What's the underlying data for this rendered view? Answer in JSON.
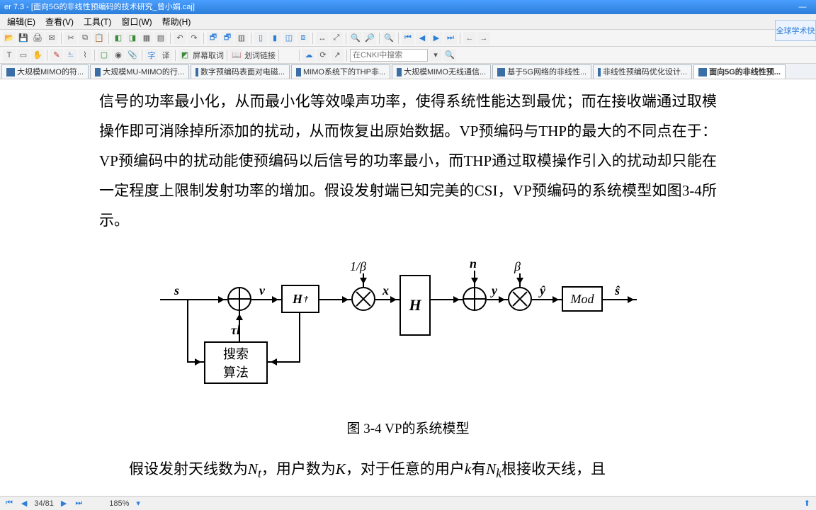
{
  "window": {
    "title_prefix": "er 7.3 - ",
    "doc_title": "[面向5G的非线性预编码的技术研究_曾小娟.caj]"
  },
  "menu": {
    "items": [
      "编辑(E)",
      "查看(V)",
      "工具(T)",
      "窗口(W)",
      "帮助(H)"
    ]
  },
  "toolbar2": {
    "layer_label": "屏幕取词",
    "dict_label": "划词链接",
    "search_placeholder": "在CNKI中搜索"
  },
  "right_float": "全球学术快",
  "tabs": [
    {
      "label": "大规模MIMO的符...",
      "active": false
    },
    {
      "label": "大规模MU-MIMO的行...",
      "active": false
    },
    {
      "label": "数字预编码表面对电磁...",
      "active": false
    },
    {
      "label": "MIMO系统下的THP非...",
      "active": false
    },
    {
      "label": "大规模MIMO无线通信...",
      "active": false
    },
    {
      "label": "基于5G网络的非线性...",
      "active": false
    },
    {
      "label": "非线性预编码优化设计...",
      "active": false
    },
    {
      "label": "面向5G的非线性预...",
      "active": true
    }
  ],
  "body": {
    "p1": "信号的功率最小化，从而最小化等效噪声功率，使得系统性能达到最优；而在接收端通过取模操作即可消除掉所添加的扰动，从而恢复出原始数据。VP预编码与THP的最大的不同点在于：VP预编码中的扰动能使预编码以后信号的功率最小，而THP通过取模操作引入的扰动却只能在一定程度上限制发射功率的增加。假设发射端已知完美的CSI，VP预编码的系统模型如图3-4所示。",
    "caption": "图 3-4 VP的系统模型",
    "p2_prefix": "假设发射天线数为",
    "p2_mid1": "，用户数为",
    "p2_mid2": "，对于任意的用户",
    "p2_mid3": "有",
    "p2_suffix": "根接收天线，且",
    "sym_Nt": "N",
    "sym_Nt_sub": "t",
    "sym_K": "K",
    "sym_K2": "K",
    "sym_k": "k",
    "sym_Nk": "N",
    "sym_Nk_sub": "k"
  },
  "diagram": {
    "s": "s",
    "v": "v",
    "x": "x",
    "y": "y",
    "yhat": "ŷ",
    "shat": "ŝ",
    "n": "n",
    "one_over_beta": "1/β",
    "beta": "β",
    "tau_l": "τl",
    "Hdag": "H",
    "dag": "†",
    "H": "H",
    "Mod": "Mod",
    "search_box_l1": "搜索",
    "search_box_l2": "算法"
  },
  "status": {
    "page": "34/81",
    "zoom": "185%"
  }
}
